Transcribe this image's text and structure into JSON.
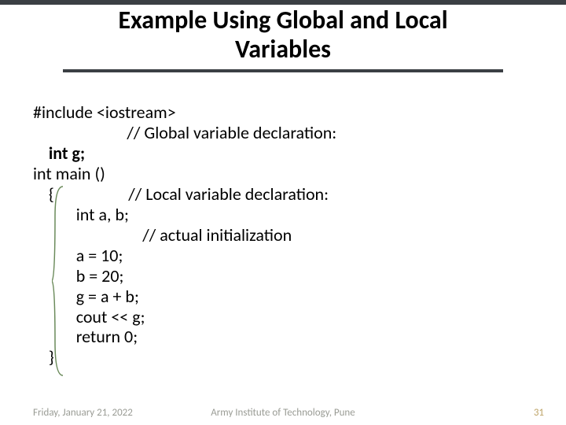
{
  "title_line1": "Example Using Global and Local",
  "title_line2": "Variables",
  "code": {
    "l1": "#include <iostream>",
    "l2": "                        // Global variable declaration:",
    "l3": "int g;",
    "l4": "int main ()",
    "l5": "    {                   // Local variable declaration:",
    "l6": "           int a, b;",
    "l7": "                            // actual initialization",
    "l8": "           a = 10;",
    "l9": "           b = 20;",
    "l10": "           g = a + b;",
    "l11": "           cout << g;",
    "l12": "           return 0;",
    "l13": "    }"
  },
  "footer": {
    "date": "Friday, January 21, 2022",
    "center": "Army Institute of Technology, Pune",
    "page": "31"
  }
}
